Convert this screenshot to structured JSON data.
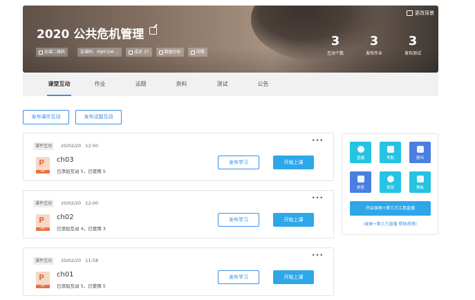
{
  "banner": {
    "title": "2020 公共危机管理",
    "change_bg": "更改背景",
    "chips": {
      "qr": "加课二维码",
      "code": "加课码：MJKFQW",
      "members": "成员 37",
      "analytics": "数据分析",
      "details": "详情"
    },
    "stats": [
      {
        "num": "3",
        "label": "互动个数"
      },
      {
        "num": "3",
        "label": "发布作业"
      },
      {
        "num": "3",
        "label": "发布测试"
      }
    ]
  },
  "tabs": [
    "课堂互动",
    "作业",
    "话题",
    "资料",
    "测试",
    "公告"
  ],
  "publish": {
    "courseware": "发布课件互动",
    "quiz": "发布试题互动"
  },
  "cards": [
    {
      "tag": "课件互动",
      "date": "20/02/20",
      "time": "12:00",
      "name": "ch03",
      "info": "已添加互动 5，已使用 5",
      "publish": "发布学习",
      "start": "开始上课",
      "ppt_letter": "P",
      "ppt_band": "PPT"
    },
    {
      "tag": "课件互动",
      "date": "20/02/20",
      "time": "12:00",
      "name": "ch02",
      "info": "已添加互动 4，已使用 3",
      "publish": "发布学习",
      "start": "开始上课",
      "ppt_letter": "P",
      "ppt_band": "PPT"
    },
    {
      "tag": "课件互动",
      "date": "20/02/20",
      "time": "11:58",
      "name": "ch01",
      "info": "已添加互动 5，已使用 5",
      "publish": "发布学习",
      "start": "开始上课",
      "ppt_letter": "P",
      "ppt_band": "PPT"
    }
  ],
  "tools": {
    "items": [
      {
        "label": "直播",
        "icon": "live-icon",
        "color": "#26c3e2"
      },
      {
        "label": "考勤",
        "icon": "attendance-icon",
        "color": "#26c3e2"
      },
      {
        "label": "提问",
        "icon": "question-icon",
        "color": "#4a7fe0"
      },
      {
        "label": "抢答",
        "icon": "quick-answer-icon",
        "color": "#4a7fe0"
      },
      {
        "label": "表现",
        "icon": "performance-icon",
        "color": "#26c3e2"
      },
      {
        "label": "黑板",
        "icon": "blackboard-icon",
        "color": "#26c3e2"
      }
    ],
    "open_live": "开启录屏+第三方工具直播",
    "help": "(录屏+第三方直播 帮助视频)"
  },
  "colors": {
    "accent": "#3a8ee6",
    "primary_button": "#2ea7e8",
    "ppt_orange": "#e6733d"
  }
}
